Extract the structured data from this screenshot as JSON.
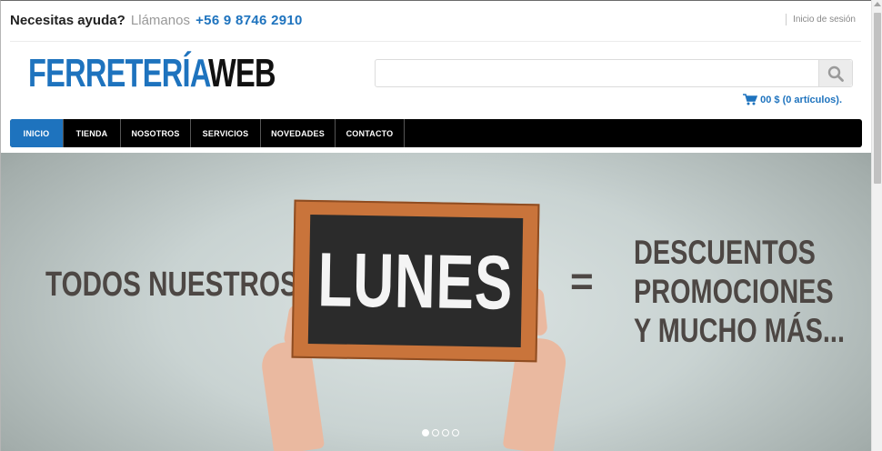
{
  "topbar": {
    "help_text": "Necesitas ayuda?",
    "call_text": "Llámanos",
    "phone": "+56 9 8746 2910",
    "login_label": "Inicio de sesión"
  },
  "logo": {
    "part1": "FERRETERÍA",
    "part2": "WEB"
  },
  "search": {
    "value": "",
    "placeholder": ""
  },
  "cart": {
    "label": "00 $ (0 artículos)."
  },
  "nav": {
    "items": [
      {
        "label": "INICIO",
        "active": true
      },
      {
        "label": "TIENDA"
      },
      {
        "label": "NOSOTROS"
      },
      {
        "label": "SERVICIOS"
      },
      {
        "label": "NOVEDADES"
      },
      {
        "label": "CONTACTO"
      }
    ]
  },
  "hero": {
    "left_text": "TODOS NUESTROS",
    "board_text": "LUNES",
    "equals": "=",
    "right_lines": [
      "DESCUENTOS",
      "PROMOCIONES",
      "Y MUCHO MÁS..."
    ],
    "slides": 4,
    "active_slide": 1
  },
  "colors": {
    "brand": "#1e73be",
    "nav_bg": "#000000",
    "text_dark": "#4d4744"
  }
}
